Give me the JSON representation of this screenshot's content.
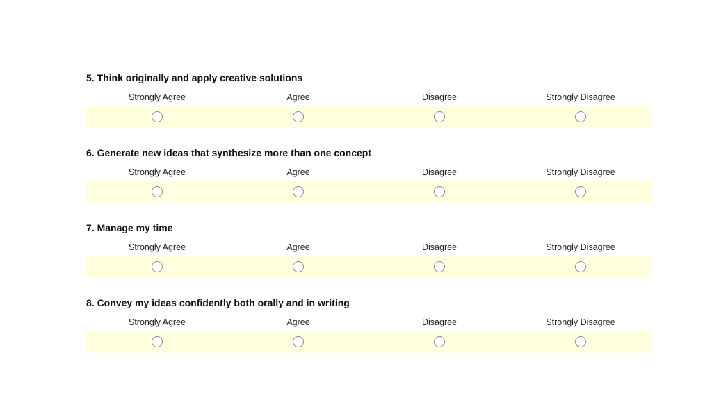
{
  "scale": [
    "Strongly Agree",
    "Agree",
    "Disagree",
    "Strongly Disagree"
  ],
  "questions": [
    {
      "title": "5. Think originally and apply creative solutions"
    },
    {
      "title": "6. Generate new ideas that synthesize more than one concept"
    },
    {
      "title": "7. Manage my time"
    },
    {
      "title": "8. Convey my ideas confidently both orally and in writing"
    }
  ],
  "colors": {
    "band_background": "#ffffe0",
    "radio_border": "#8a8a8a"
  }
}
